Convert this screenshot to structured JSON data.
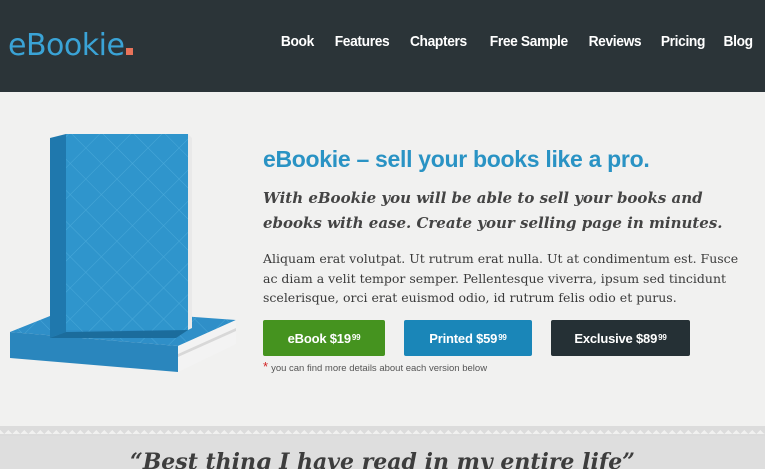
{
  "brand": {
    "name": "eBookie",
    "accent_color": "#3aa3d6",
    "dot_color": "#e8735a"
  },
  "nav": {
    "items": [
      {
        "label": "Book"
      },
      {
        "label": "Features"
      },
      {
        "label": "Chapters"
      },
      {
        "label": "Free Sample"
      },
      {
        "label": "Reviews"
      },
      {
        "label": "Pricing"
      },
      {
        "label": "Blog"
      }
    ]
  },
  "hero": {
    "headline": "eBookie – sell your books like a pro.",
    "lead": "With eBookie you will be able to sell your books and ebooks with ease. Create your selling page in minutes.",
    "body": "Aliquam erat volutpat. Ut rutrum erat nulla. Ut at condimentum est. Fusce ac diam a velit tempor semper. Pellentesque viverra, ipsum sed tincidunt scelerisque, orci erat euismod odio, id rutrum felis odio et purus.",
    "book_icon": "blue-book-icon"
  },
  "buttons": {
    "ebook": {
      "label": "eBook $19",
      "cents": "99",
      "color": "#45931f"
    },
    "printed": {
      "label": "Printed $59",
      "cents": "99",
      "color": "#1a86b8"
    },
    "exclusive": {
      "label": "Exclusive $89",
      "cents": "99",
      "color": "#253035"
    }
  },
  "note": {
    "star": "*",
    "text": "you can find more details about each version below"
  },
  "testimonial": {
    "quote": "“Best thing I have read in my entire life”"
  }
}
